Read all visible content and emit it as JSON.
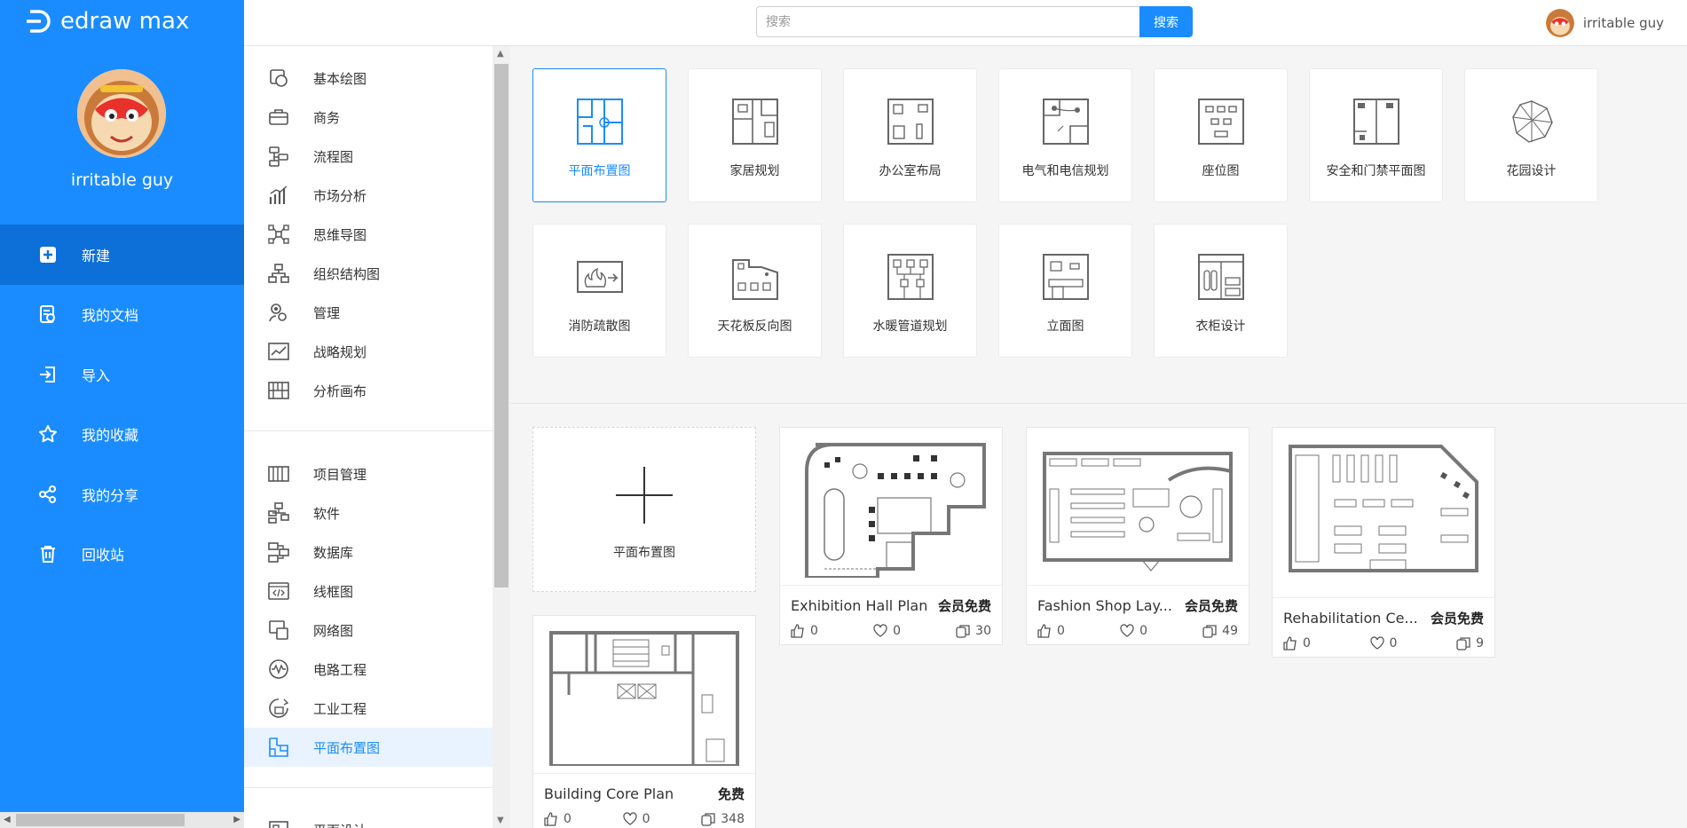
{
  "brand": {
    "name": "edraw max"
  },
  "user": {
    "name": "irritable guy"
  },
  "nav": [
    {
      "label": "新建",
      "icon": "new-file-icon"
    },
    {
      "label": "我的文档",
      "icon": "documents-icon"
    },
    {
      "label": "导入",
      "icon": "import-icon"
    },
    {
      "label": "我的收藏",
      "icon": "star-icon"
    },
    {
      "label": "我的分享",
      "icon": "share-icon"
    },
    {
      "label": "回收站",
      "icon": "trash-icon"
    }
  ],
  "search": {
    "placeholder": "搜索",
    "button": "搜索"
  },
  "categories": [
    {
      "label": "基本绘图"
    },
    {
      "label": "商务"
    },
    {
      "label": "流程图"
    },
    {
      "label": "市场分析"
    },
    {
      "label": "思维导图"
    },
    {
      "label": "组织结构图"
    },
    {
      "label": "管理"
    },
    {
      "label": "战略规划"
    },
    {
      "label": "分析画布"
    },
    {
      "label": "项目管理"
    },
    {
      "label": "软件"
    },
    {
      "label": "数据库"
    },
    {
      "label": "线框图"
    },
    {
      "label": "网络图"
    },
    {
      "label": "电路工程"
    },
    {
      "label": "工业工程"
    },
    {
      "label": "平面布置图"
    },
    {
      "label": "平面设计"
    }
  ],
  "types": [
    {
      "label": "平面布置图"
    },
    {
      "label": "家居规划"
    },
    {
      "label": "办公室布局"
    },
    {
      "label": "电气和电信规划"
    },
    {
      "label": "座位图"
    },
    {
      "label": "安全和门禁平面图"
    },
    {
      "label": "花园设计"
    },
    {
      "label": "消防疏散图"
    },
    {
      "label": "天花板反向图"
    },
    {
      "label": "水暖管道规划"
    },
    {
      "label": "立面图"
    },
    {
      "label": "衣柜设计"
    }
  ],
  "new_card": {
    "label": "平面布置图"
  },
  "templates": [
    {
      "title": "Exhibition Hall Plan",
      "badge": "会员免费",
      "likes": "0",
      "favorites": "0",
      "copies": "30"
    },
    {
      "title": "Fashion Shop Lay...",
      "badge": "会员免费",
      "likes": "0",
      "favorites": "0",
      "copies": "49"
    },
    {
      "title": "Rehabilitation Ce...",
      "badge": "会员免费",
      "likes": "0",
      "favorites": "0",
      "copies": "9"
    },
    {
      "title": "Building Core Plan",
      "badge": "免费",
      "likes": "0",
      "favorites": "0",
      "copies": "348"
    }
  ],
  "colors": {
    "primary": "#1a8cff",
    "sidebar_active": "#0d6fd8"
  }
}
